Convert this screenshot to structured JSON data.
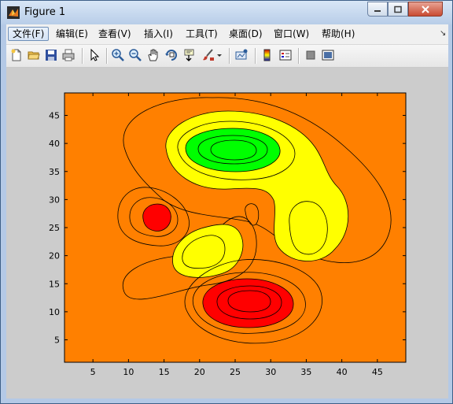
{
  "window": {
    "title": "Figure 1"
  },
  "menu": [
    "文件(F)",
    "编辑(E)",
    "查看(V)",
    "插入(I)",
    "工具(T)",
    "桌面(D)",
    "窗口(W)",
    "帮助(H)"
  ],
  "toolbar_icons": [
    "new-figure-icon",
    "open-file-icon",
    "save-icon",
    "print-icon",
    "edit-plot-arrow-icon",
    "zoom-in-icon",
    "zoom-out-icon",
    "pan-hand-icon",
    "rotate-3d-icon",
    "data-cursor-icon",
    "brush-icon",
    "colorbar-icon",
    "legend-icon",
    "hide-plot-tools-icon",
    "show-plot-tools-icon"
  ],
  "colors": {
    "orange": "#ff8000",
    "yellow": "#ffff00",
    "green": "#00ff00",
    "red": "#ff0000",
    "figure_bg": "#cccccc"
  },
  "chart_data": {
    "type": "contour",
    "colormap": [
      "red",
      "orange",
      "yellow",
      "green"
    ],
    "xlim": [
      1,
      49
    ],
    "ylim": [
      1,
      49
    ],
    "xticks": [
      5,
      10,
      15,
      20,
      25,
      30,
      35,
      40,
      45
    ],
    "yticks": [
      5,
      10,
      15,
      20,
      25,
      30,
      35,
      40,
      45
    ],
    "title": "",
    "xlabel": "",
    "ylabel": "",
    "peaks": [
      {
        "x": 25,
        "y": 37.5,
        "fill": "green"
      },
      {
        "x": 27.5,
        "y": 11.5,
        "fill": "red"
      },
      {
        "x": 14,
        "y": 26.5,
        "fill": "red"
      },
      {
        "x": 21,
        "y": 19.5,
        "fill": "yellow"
      },
      {
        "x": 35,
        "y": 25,
        "fill": "yellow"
      }
    ]
  }
}
